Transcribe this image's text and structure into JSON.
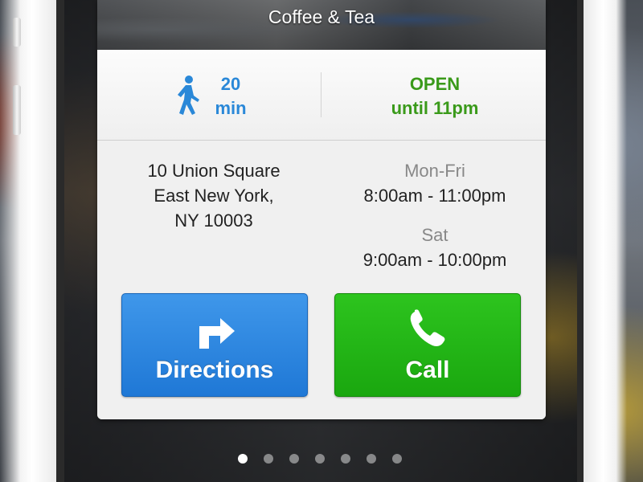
{
  "place": {
    "category": "Coffee & Tea"
  },
  "status": {
    "walk_minutes": "20",
    "walk_unit": "min",
    "open_label": "OPEN",
    "open_until": "until 11pm"
  },
  "address": {
    "line1": "10 Union Square",
    "line2": "East New York,",
    "line3": "NY 10003"
  },
  "hours": [
    {
      "day": "Mon-Fri",
      "time": "8:00am - 11:00pm"
    },
    {
      "day": "Sat",
      "time": "9:00am - 10:00pm"
    }
  ],
  "buttons": {
    "directions": "Directions",
    "call": "Call"
  },
  "icons": {
    "walk": "walking-person-icon",
    "directions": "turn-right-arrow-icon",
    "call": "phone-handset-icon"
  },
  "pager": {
    "count": 7,
    "active_index": 0
  },
  "colors": {
    "walk_blue": "#2a88d8",
    "open_green": "#3a9a1a",
    "directions_blue": "#1f78d6",
    "call_green": "#1aa70f"
  }
}
